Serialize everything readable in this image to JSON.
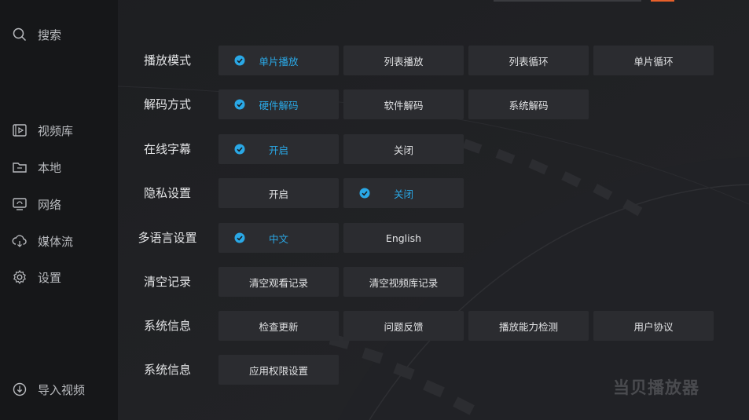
{
  "sidebar": {
    "search": "搜索",
    "items": [
      {
        "label": "视频库",
        "icon": "video-library-icon"
      },
      {
        "label": "本地",
        "icon": "folder-icon"
      },
      {
        "label": "网络",
        "icon": "network-icon"
      },
      {
        "label": "媒体流",
        "icon": "cloud-stream-icon"
      },
      {
        "label": "设置",
        "icon": "gear-icon"
      }
    ],
    "import": "导入视频"
  },
  "settings": [
    {
      "label": "播放模式",
      "options": [
        {
          "label": "单片播放",
          "selected": true
        },
        {
          "label": "列表播放",
          "selected": false
        },
        {
          "label": "列表循环",
          "selected": false
        },
        {
          "label": "单片循环",
          "selected": false
        }
      ]
    },
    {
      "label": "解码方式",
      "options": [
        {
          "label": "硬件解码",
          "selected": true
        },
        {
          "label": "软件解码",
          "selected": false
        },
        {
          "label": "系统解码",
          "selected": false
        }
      ]
    },
    {
      "label": "在线字幕",
      "options": [
        {
          "label": "开启",
          "selected": true
        },
        {
          "label": "关闭",
          "selected": false
        }
      ]
    },
    {
      "label": "隐私设置",
      "options": [
        {
          "label": "开启",
          "selected": false
        },
        {
          "label": "关闭",
          "selected": true
        }
      ]
    },
    {
      "label": "多语言设置",
      "options": [
        {
          "label": "中文",
          "selected": true
        },
        {
          "label": "English",
          "selected": false
        }
      ]
    },
    {
      "label": "清空记录",
      "options": [
        {
          "label": "清空观看记录",
          "selected": false
        },
        {
          "label": "清空视频库记录",
          "selected": false
        }
      ]
    },
    {
      "label": "系统信息",
      "options": [
        {
          "label": "检查更新",
          "selected": false
        },
        {
          "label": "问题反馈",
          "selected": false
        },
        {
          "label": "播放能力检测",
          "selected": false
        },
        {
          "label": "用户协议",
          "selected": false
        }
      ]
    },
    {
      "label": "系统信息",
      "options": [
        {
          "label": "应用权限设置",
          "selected": false
        }
      ]
    }
  ],
  "watermark": "当贝播放器",
  "colors": {
    "accent": "#2aa8e6",
    "top_accent": "#e8602a"
  }
}
